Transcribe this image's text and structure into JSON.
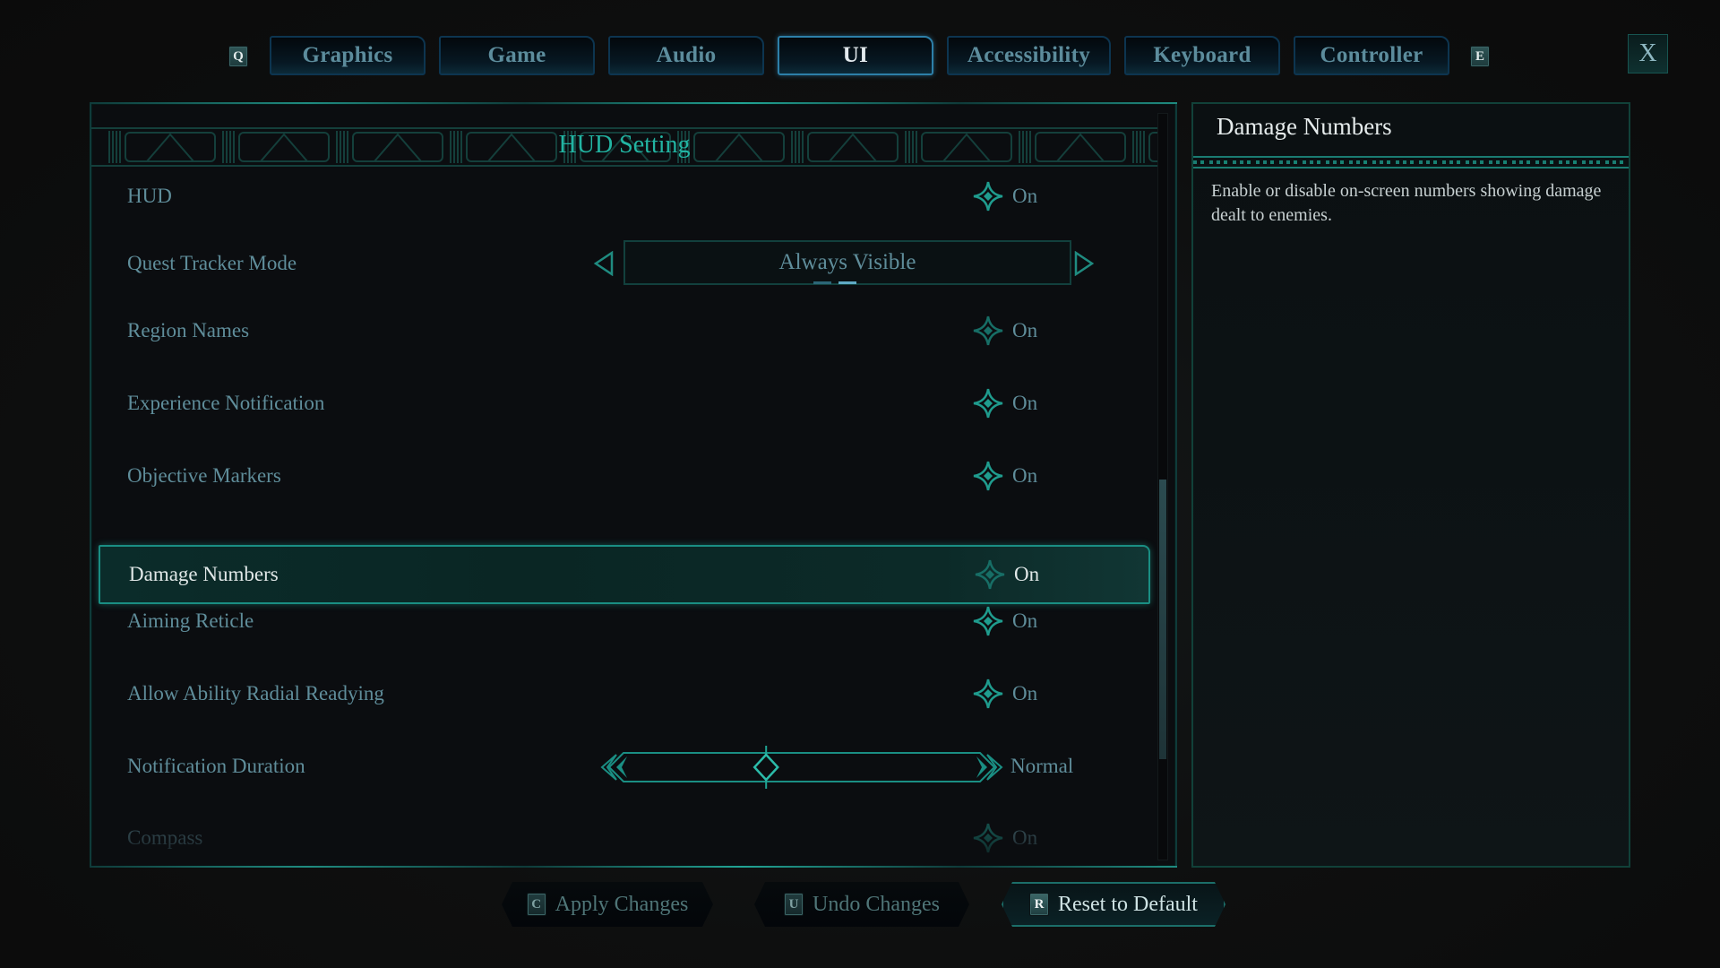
{
  "tabs": {
    "prev_key": "Q",
    "next_key": "E",
    "items": [
      {
        "label": "Graphics",
        "active": false
      },
      {
        "label": "Game",
        "active": false
      },
      {
        "label": "Audio",
        "active": false
      },
      {
        "label": "UI",
        "active": true
      },
      {
        "label": "Accessibility",
        "active": false
      },
      {
        "label": "Keyboard",
        "active": false
      },
      {
        "label": "Controller",
        "active": false
      }
    ],
    "close_label": "X"
  },
  "main": {
    "section_title": "HUD Setting",
    "rows": [
      {
        "label": "HUD",
        "type": "toggle",
        "value": "On"
      },
      {
        "label": "Quest Tracker Mode",
        "type": "selector",
        "value": "Always Visible",
        "option_index": 2,
        "option_count": 2
      },
      {
        "label": "Region Names",
        "type": "toggle",
        "value": "On"
      },
      {
        "label": "Experience Notification",
        "type": "toggle",
        "value": "On"
      },
      {
        "label": "Objective Markers",
        "type": "toggle",
        "value": "On"
      },
      {
        "label": "Damage Numbers",
        "type": "toggle",
        "value": "On",
        "selected": true
      },
      {
        "label": "Aiming Reticle",
        "type": "toggle",
        "value": "On"
      },
      {
        "label": "Allow Ability Radial Readying",
        "type": "toggle",
        "value": "On"
      },
      {
        "label": "Notification Duration",
        "type": "slider",
        "value": "Normal",
        "slider_fraction": 0.4
      },
      {
        "label": "Compass",
        "type": "toggle",
        "value": "On",
        "partially_visible": true
      }
    ],
    "scroll_fraction_visible": 0.37
  },
  "description": {
    "title": "Damage Numbers",
    "body": "Enable or disable on-screen numbers showing damage dealt to enemies."
  },
  "actions": [
    {
      "key": "C",
      "label": "Apply Changes",
      "primary": false
    },
    {
      "key": "U",
      "label": "Undo Changes",
      "primary": false
    },
    {
      "key": "R",
      "label": "Reset to Default",
      "primary": true
    }
  ],
  "colors": {
    "accent_teal": "#21a394",
    "title_teal": "#22b4a2",
    "tab_active_border": "#2d7fa8",
    "text_muted": "#5f8d9a",
    "text_bright": "#e1e8e8"
  }
}
